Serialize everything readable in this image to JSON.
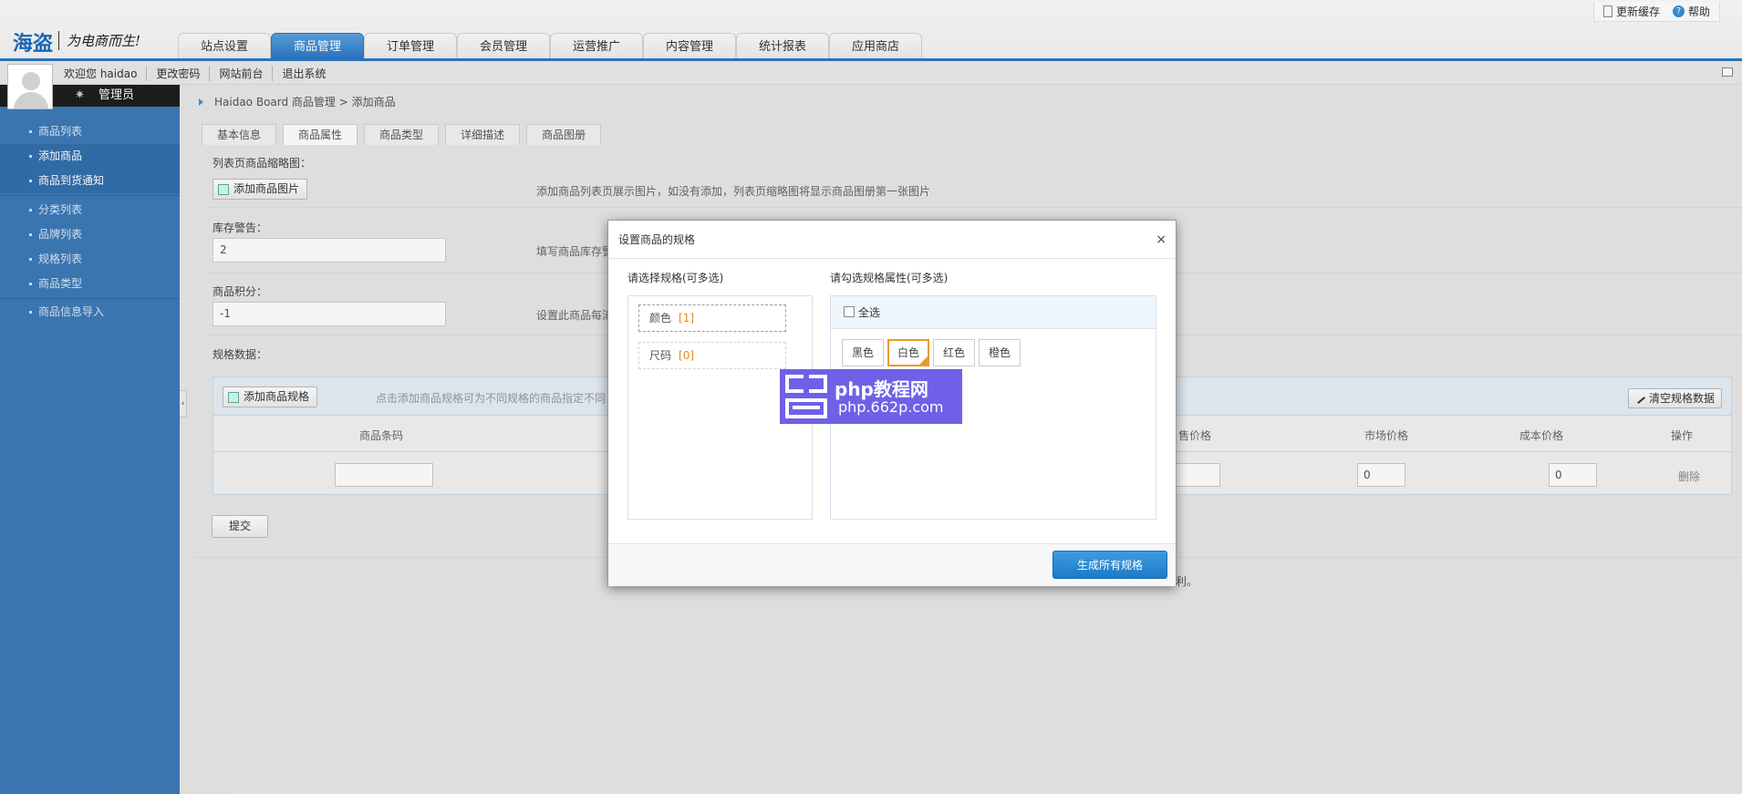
{
  "header": {
    "logo": "海盗",
    "slogan": "为电商而生!",
    "links": {
      "refresh_cache": "更新缓存",
      "help": "帮助"
    }
  },
  "main_nav": [
    {
      "label": "站点设置",
      "active": false
    },
    {
      "label": "商品管理",
      "active": true
    },
    {
      "label": "订单管理",
      "active": false
    },
    {
      "label": "会员管理",
      "active": false
    },
    {
      "label": "运营推广",
      "active": false
    },
    {
      "label": "内容管理",
      "active": false
    },
    {
      "label": "统计报表",
      "active": false
    },
    {
      "label": "应用商店",
      "active": false
    }
  ],
  "subbar": {
    "welcome": "欢迎您 haidao",
    "change_password": "更改密码",
    "frontend": "网站前台",
    "logout": "退出系统"
  },
  "sidebar": {
    "role": "管理员",
    "groups": [
      [
        "商品列表",
        "添加商品",
        "商品到货通知"
      ],
      [
        "分类列表",
        "品牌列表",
        "规格列表",
        "商品类型"
      ],
      [
        "商品信息导入"
      ]
    ],
    "active_item": "添加商品"
  },
  "breadcrumb": "Haidao Board 商品管理 > 添加商品",
  "content_tabs": [
    {
      "label": "基本信息",
      "active": false
    },
    {
      "label": "商品属性",
      "active": true
    },
    {
      "label": "商品类型",
      "active": false
    },
    {
      "label": "详细描述",
      "active": false
    },
    {
      "label": "商品图册",
      "active": false
    }
  ],
  "form": {
    "thumb_label": "列表页商品缩略图：",
    "thumb_button": "添加商品图片",
    "thumb_hint": "添加商品列表页展示图片，如没有添加，列表页缩略图将显示商品图册第一张图片",
    "stock_label": "库存警告：",
    "stock_value": "2",
    "stock_hint": "填写商品库存警",
    "points_label": "商品积分：",
    "points_value": "-1",
    "points_hint": "设置此商品每消",
    "spec_label": "规格数据：",
    "add_spec_button": "添加商品规格",
    "add_spec_hint": "点击添加商品规格可为不同规格的商品指定不同",
    "clear_button": "清空规格数据",
    "columns": [
      "商品条码",
      "售价格",
      "市场价格",
      "成本价格",
      "操作"
    ],
    "row": {
      "market_price": "0",
      "cost_price": "0",
      "delete": "删除"
    },
    "submit": "提交",
    "footer_tail": "权利。"
  },
  "dialog": {
    "title": "设置商品的规格",
    "close": "×",
    "left_label": "请选择规格(可多选)",
    "right_label": "请勾选规格属性(可多选)",
    "specs": [
      {
        "name": "颜色",
        "count": "[1]"
      },
      {
        "name": "尺码",
        "count": "[0]"
      }
    ],
    "select_all": "全选",
    "options": [
      {
        "label": "黑色",
        "selected": false
      },
      {
        "label": "白色",
        "selected": true
      },
      {
        "label": "红色",
        "selected": false
      },
      {
        "label": "橙色",
        "selected": false
      }
    ],
    "generate_button": "生成所有规格"
  },
  "watermark": {
    "line1": "php教程网",
    "line2": "php.662p.com"
  },
  "colors": {
    "nav_active": "#2b78c2",
    "sidebar": "#3d7ab8",
    "accent_orange": "#e89a2e",
    "primary_button": "#1d7bc8",
    "watermark": "#7060e8"
  }
}
